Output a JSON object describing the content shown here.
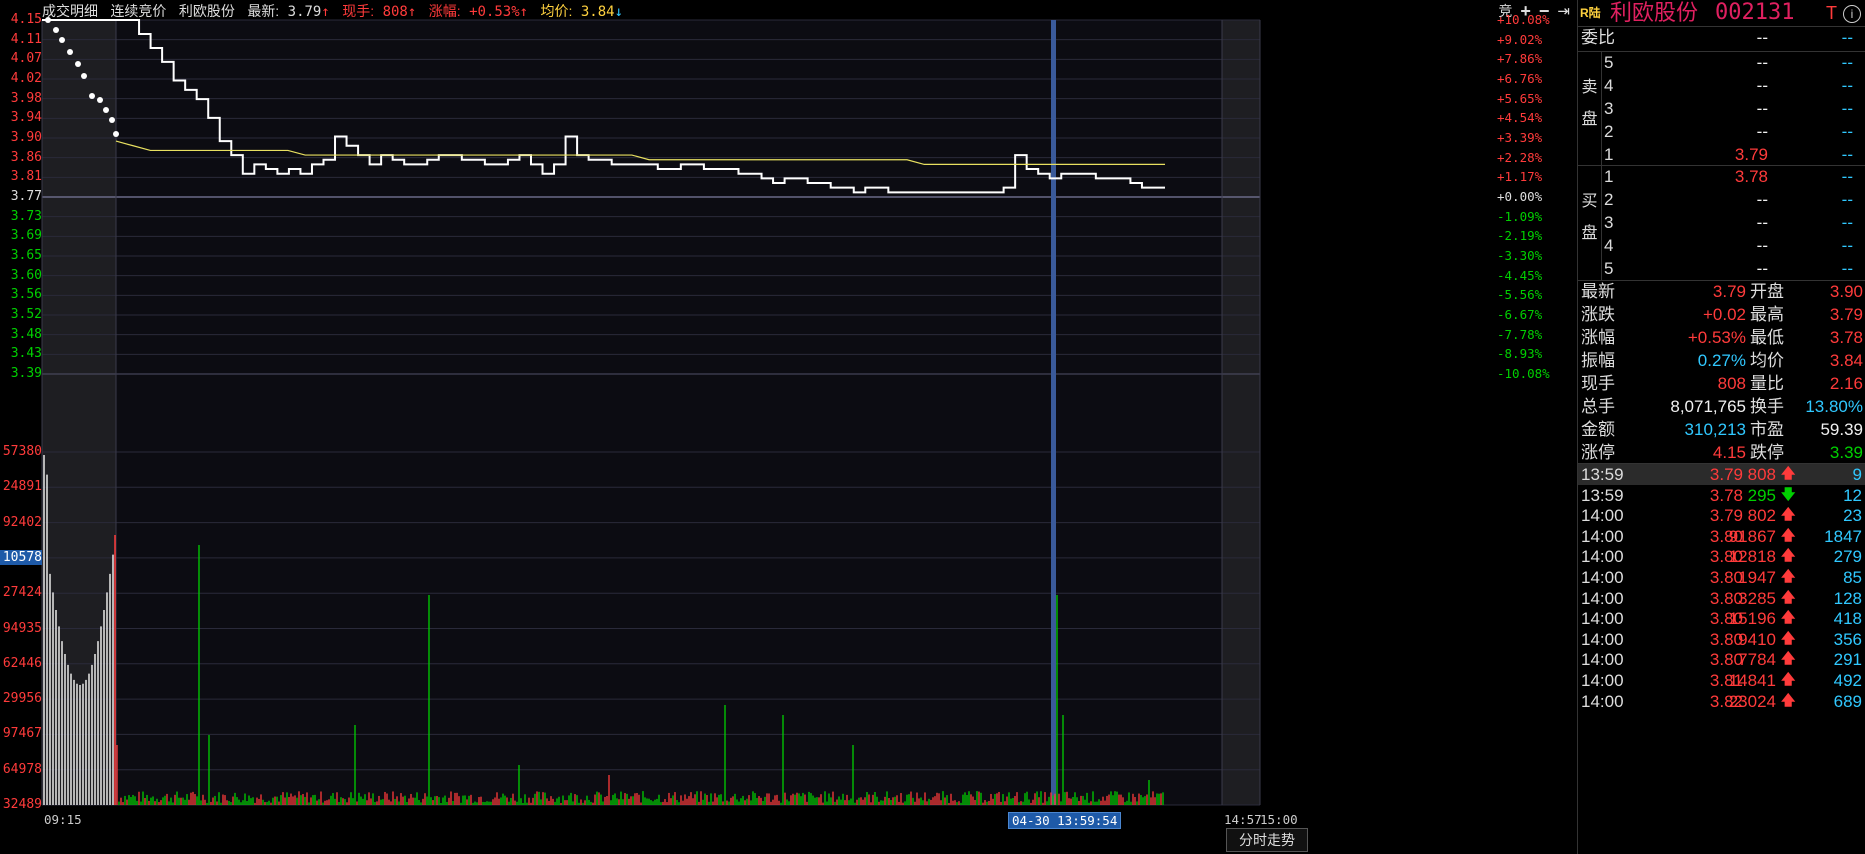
{
  "header": {
    "tab_detail": "成交明细",
    "tab_auction": "连续竞价",
    "stock_name": "利欧股份",
    "latest_label": "最新:",
    "latest_value": "3.79",
    "current_hand_label": "现手:",
    "current_hand_value": "808",
    "change_pct_label": "涨幅:",
    "change_pct_value": "+0.53%",
    "avg_label": "均价:",
    "avg_value": "3.84",
    "auction_btn": "竞"
  },
  "price_axis_left": [
    "4.15",
    "4.11",
    "4.07",
    "4.02",
    "3.98",
    "3.94",
    "3.90",
    "3.86",
    "3.81",
    "3.77",
    "3.73",
    "3.69",
    "3.65",
    "3.60",
    "3.56",
    "3.52",
    "3.48",
    "3.43",
    "3.39"
  ],
  "price_axis_right": [
    "+10.08%",
    "+9.02%",
    "+7.86%",
    "+6.76%",
    "+5.65%",
    "+4.54%",
    "+3.39%",
    "+2.28%",
    "+1.17%",
    "+0.00%",
    "-1.09%",
    "-2.19%",
    "-3.30%",
    "-4.45%",
    "-5.56%",
    "-6.67%",
    "-7.78%",
    "-8.93%",
    "-10.08%"
  ],
  "volume_axis": [
    "57380",
    "24891",
    "92402",
    "10578",
    "27424",
    "94935",
    "62446",
    "29956",
    "97467",
    "64978",
    "32489"
  ],
  "time_axis": {
    "start": "09:15",
    "cursor": "04-30 13:59:54",
    "end1": "14:57",
    "end2": "15:00"
  },
  "bottom_tab": "分时走势",
  "colors": {
    "up": "#ff3b3b",
    "down": "#00d000",
    "price_line": "#ffffff",
    "avg_line": "#e8e060",
    "cursor": "#3a5a9a"
  },
  "chart_data": {
    "type": "line",
    "title": "",
    "ylim": [
      3.39,
      4.15
    ],
    "prev_close": 3.77,
    "series": [
      {
        "name": "",
        "values": [
          4.15,
          4.15,
          4.12,
          4.09,
          4.06,
          4.02,
          4.0,
          3.98,
          3.94,
          3.89,
          3.86,
          3.82,
          3.84,
          3.83,
          3.82,
          3.83,
          3.82,
          3.84,
          3.85,
          3.9,
          3.88,
          3.86,
          3.84,
          3.86,
          3.85,
          3.84,
          3.84,
          3.85,
          3.86,
          3.86,
          3.85,
          3.85,
          3.84,
          3.84,
          3.85,
          3.86,
          3.84,
          3.82,
          3.84,
          3.9,
          3.86,
          3.85,
          3.85,
          3.84,
          3.84,
          3.84,
          3.84,
          3.83,
          3.83,
          3.84,
          3.84,
          3.83,
          3.83,
          3.83,
          3.82,
          3.82,
          3.81,
          3.8,
          3.81,
          3.81,
          3.8,
          3.8,
          3.79,
          3.79,
          3.78,
          3.79,
          3.79,
          3.78,
          3.78,
          3.78,
          3.78,
          3.78,
          3.78,
          3.78,
          3.78,
          3.78,
          3.78,
          3.79,
          3.86,
          3.83,
          3.82,
          3.81,
          3.82,
          3.82,
          3.82,
          3.81,
          3.81,
          3.81,
          3.8,
          3.79,
          3.79,
          3.79
        ]
      },
      {
        "name": "",
        "values": [
          3.89,
          3.88,
          3.87,
          3.87,
          3.87,
          3.87,
          3.87,
          3.87,
          3.87,
          3.87,
          3.87,
          3.86,
          3.86,
          3.86,
          3.86,
          3.86,
          3.86,
          3.86,
          3.86,
          3.86,
          3.86,
          3.86,
          3.86,
          3.86,
          3.86,
          3.86,
          3.86,
          3.86,
          3.86,
          3.86,
          3.86,
          3.85,
          3.85,
          3.85,
          3.85,
          3.85,
          3.85,
          3.85,
          3.85,
          3.85,
          3.85,
          3.85,
          3.85,
          3.85,
          3.85,
          3.85,
          3.85,
          3.84,
          3.84,
          3.84,
          3.84,
          3.84,
          3.84,
          3.84,
          3.84,
          3.84,
          3.84,
          3.84,
          3.84,
          3.84,
          3.84,
          3.84
        ]
      }
    ],
    "volume_ylim": [
      0,
      57380
    ]
  },
  "side": {
    "r_label": "R陆",
    "name": "利欧股份",
    "code": "002131",
    "t_mark": "T",
    "info_icon": "i",
    "weibi_label": "委比",
    "weibi_val": "--",
    "weibi_val2": "--",
    "sell_title": [
      "卖",
      "盘"
    ],
    "buy_title": [
      "买",
      "盘"
    ],
    "sell_rows": [
      {
        "lvl": "5",
        "price": "--",
        "vol": "--"
      },
      {
        "lvl": "4",
        "price": "--",
        "vol": "--"
      },
      {
        "lvl": "3",
        "price": "--",
        "vol": "--"
      },
      {
        "lvl": "2",
        "price": "--",
        "vol": "--"
      },
      {
        "lvl": "1",
        "price": "3.79",
        "vol": "--"
      }
    ],
    "buy_rows": [
      {
        "lvl": "1",
        "price": "3.78",
        "vol": "--"
      },
      {
        "lvl": "2",
        "price": "--",
        "vol": "--"
      },
      {
        "lvl": "3",
        "price": "--",
        "vol": "--"
      },
      {
        "lvl": "4",
        "price": "--",
        "vol": "--"
      },
      {
        "lvl": "5",
        "price": "--",
        "vol": "--"
      }
    ],
    "stats": [
      {
        "l1": "最新",
        "v1": "3.79",
        "c1": "red",
        "l2": "开盘",
        "v2": "3.90",
        "c2": "red"
      },
      {
        "l1": "涨跌",
        "v1": "+0.02",
        "c1": "red",
        "l2": "最高",
        "v2": "3.79",
        "c2": "red"
      },
      {
        "l1": "涨幅",
        "v1": "+0.53%",
        "c1": "red",
        "l2": "最低",
        "v2": "3.78",
        "c2": "red"
      },
      {
        "l1": "振幅",
        "v1": "0.27%",
        "c1": "cyan",
        "l2": "均价",
        "v2": "3.84",
        "c2": "red"
      },
      {
        "l1": "现手",
        "v1": "808",
        "c1": "red",
        "l2": "量比",
        "v2": "2.16",
        "c2": "red"
      },
      {
        "l1": "总手",
        "v1": "8,071,765",
        "c1": "white",
        "l2": "换手",
        "v2": "13.80%",
        "c2": "cyan"
      },
      {
        "l1": "金额",
        "v1": "310,213",
        "c1": "cyan",
        "l2": "市盈",
        "v2": "59.39",
        "c2": "white"
      },
      {
        "l1": "涨停",
        "v1": "4.15",
        "c1": "red",
        "l2": "跌停",
        "v2": "3.39",
        "c2": "green"
      }
    ],
    "trades": [
      {
        "t": "13:59",
        "p": "3.79",
        "pc": "red",
        "v": "808",
        "vc": "red",
        "dir": "up",
        "n": "9"
      },
      {
        "t": "13:59",
        "p": "3.78",
        "pc": "red",
        "v": "295",
        "vc": "green",
        "dir": "down",
        "n": "12"
      },
      {
        "t": "14:00",
        "p": "3.79",
        "pc": "red",
        "v": "802",
        "vc": "red",
        "dir": "up",
        "n": "23"
      },
      {
        "t": "14:00",
        "p": "3.80",
        "pc": "red",
        "v": "91867",
        "vc": "red",
        "dir": "up",
        "n": "1847"
      },
      {
        "t": "14:00",
        "p": "3.80",
        "pc": "red",
        "v": "12818",
        "vc": "red",
        "dir": "up",
        "n": "279"
      },
      {
        "t": "14:00",
        "p": "3.80",
        "pc": "red",
        "v": "1947",
        "vc": "red",
        "dir": "up",
        "n": "85"
      },
      {
        "t": "14:00",
        "p": "3.80",
        "pc": "red",
        "v": "3285",
        "vc": "red",
        "dir": "up",
        "n": "128"
      },
      {
        "t": "14:00",
        "p": "3.80",
        "pc": "red",
        "v": "15196",
        "vc": "red",
        "dir": "up",
        "n": "418"
      },
      {
        "t": "14:00",
        "p": "3.80",
        "pc": "red",
        "v": "9410",
        "vc": "red",
        "dir": "up",
        "n": "356"
      },
      {
        "t": "14:00",
        "p": "3.80",
        "pc": "red",
        "v": "7784",
        "vc": "red",
        "dir": "up",
        "n": "291"
      },
      {
        "t": "14:00",
        "p": "3.81",
        "pc": "red",
        "v": "14841",
        "vc": "red",
        "dir": "up",
        "n": "492"
      },
      {
        "t": "14:00",
        "p": "3.82",
        "pc": "red",
        "v": "23024",
        "vc": "red",
        "dir": "up",
        "n": "689"
      }
    ]
  }
}
